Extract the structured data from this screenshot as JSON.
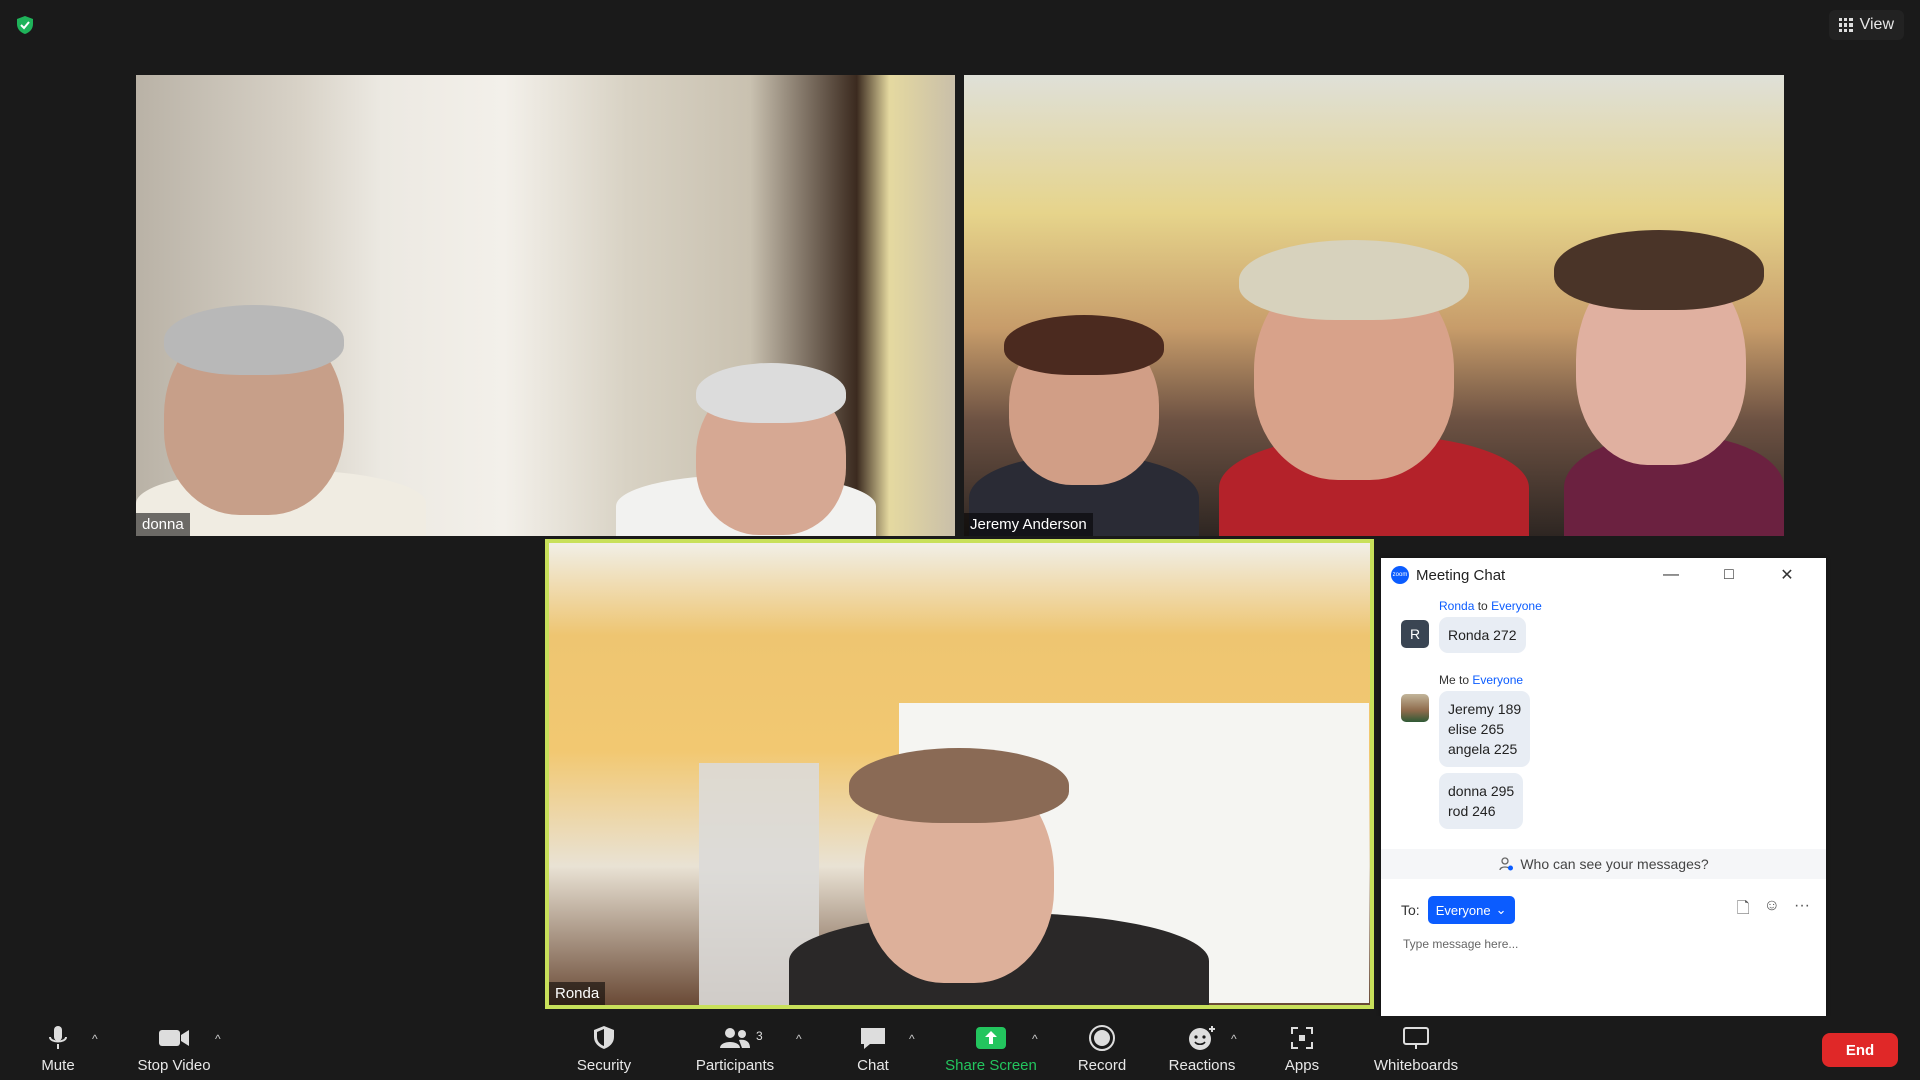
{
  "top": {
    "view_label": "View"
  },
  "tiles": {
    "donna": {
      "name": "donna"
    },
    "jeremy": {
      "name": "Jeremy Anderson"
    },
    "ronda": {
      "name": "Ronda"
    }
  },
  "chat": {
    "title": "Meeting Chat",
    "messages": [
      {
        "sender": "Ronda",
        "to_word": "to",
        "recipient": "Everyone",
        "avatar_letter": "R",
        "bubbles": [
          [
            "Ronda 272"
          ]
        ]
      },
      {
        "sender": "Me",
        "to_word": "to",
        "recipient": "Everyone",
        "bubbles": [
          [
            "Jeremy 189",
            "elise 265",
            "angela 225"
          ],
          [
            "donna 295",
            "rod 246"
          ]
        ]
      }
    ],
    "privacy_text": "Who can see your messages?",
    "to_label": "To:",
    "to_value": "Everyone",
    "input_placeholder": "Type message here..."
  },
  "toolbar": {
    "mute": "Mute",
    "stop_video": "Stop Video",
    "security": "Security",
    "participants": "Participants",
    "participants_count": "3",
    "chat": "Chat",
    "share_screen": "Share Screen",
    "record": "Record",
    "reactions": "Reactions",
    "apps": "Apps",
    "whiteboards": "Whiteboards",
    "end": "End"
  },
  "colors": {
    "active_speaker_border": "#c8e05a",
    "share_green": "#23c55e",
    "end_red": "#e02828",
    "accent_blue": "#0b5cff"
  }
}
